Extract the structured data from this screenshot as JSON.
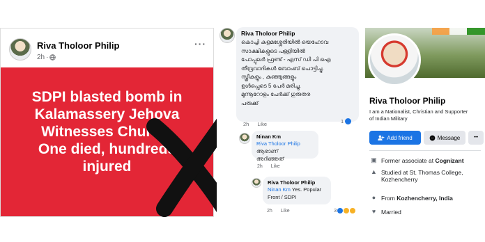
{
  "post": {
    "author": "Riva Tholoor Philip",
    "time": "2h",
    "privacy_icon": "globe-icon",
    "menu_icon": "more-horizontal-icon",
    "image_text_lines": [
      "SDPI blasted bomb in",
      "Kalamassery Jehova",
      "Witnesses Church.",
      "One died, hundreds",
      "injured"
    ],
    "colors": {
      "card_bg": "#e32636",
      "cross": "#111111"
    },
    "overlay": "cross-mark"
  },
  "comments": {
    "main": {
      "author": "Riva Tholoor Philip",
      "text_lines": [
        "കൊച്ചി കളമശ്ശേരിയിൽ യെഹോവ",
        "സാക്ഷികളുടെ പള്ളിയിൽ",
        "പോപ്പുലർ ഫ്രണ്ട് - എസ് ഡി പി ഐ",
        "തീവ്രവാദികൾ ബോംബ് പൊട്ടിച്ചു.",
        "സ്ത്രീകളും , കുഞ്ഞുങ്ങളും",
        "ഉൾപ്പെടെ 5 പേർ മരിച്ചു.",
        "മുന്നൂറോളം പേർക്ക് ഗുരുതര",
        "പരുക്ക്"
      ],
      "time": "2h",
      "like": "Like",
      "reaction_count": "1"
    },
    "reply1": {
      "author": "Ninan Km",
      "mention": "Riva Tholoor Philip",
      "text_line1": "ആരാണ്",
      "text_line2": "അറിഞ്ഞത്",
      "time": "2h",
      "like": "Like",
      "reaction_count": "1"
    },
    "reply2": {
      "author": "Riva Tholoor Philip",
      "mention": "Ninan Km",
      "text_line1": "Yes. Popular",
      "text_line2": "Front / SDPI",
      "time": "2h",
      "like": "Like",
      "reaction_count": "3"
    }
  },
  "profile": {
    "name": "Riva Tholoor Philip",
    "bio_line1": "I am a Nationalist, Christian and Supporter",
    "bio_line2": "of Indian Military",
    "add_friend": "Add friend",
    "message": "Message",
    "more": "•••",
    "details": [
      {
        "icon": "briefcase-icon",
        "prefix": "Former associate at ",
        "bold": "Cognizant"
      },
      {
        "icon": "graduation-cap-icon",
        "prefix": "Studied at St. Thomas College,",
        "line2": "Kozhencherry"
      },
      {
        "icon": "location-pin-icon",
        "prefix": "From ",
        "bold": "Kozhencherry, India"
      },
      {
        "icon": "heart-icon",
        "prefix": "Married"
      }
    ],
    "colors": {
      "primary": "#1b74e4"
    }
  }
}
